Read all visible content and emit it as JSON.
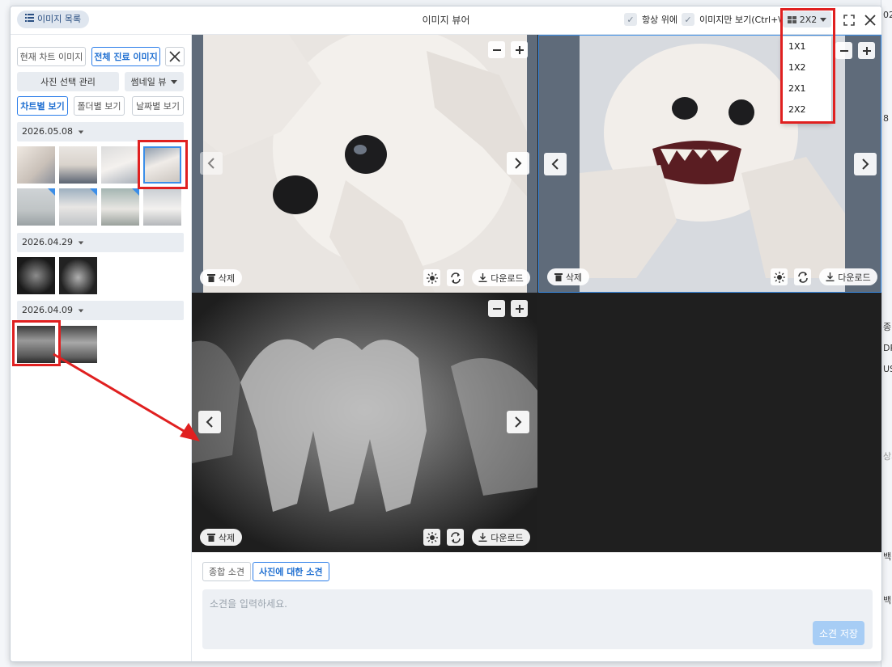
{
  "window": {
    "title": "이미지 뷰어",
    "list_button_label": "이미지 목록",
    "always_on_top_label": "항상 위에",
    "image_only_label": "이미지만 보기(Ctrl+\\)",
    "layout_selected": "2X2",
    "layout_options": [
      "1X1",
      "1X2",
      "2X1",
      "2X2"
    ]
  },
  "sidebar": {
    "btn_current_chart": "현재 차트 이미지",
    "btn_all_records": "전체 진료 이미지",
    "btn_photo_manage": "사진 선택 관리",
    "btn_thumbnail_view": "썸네일 뷰",
    "view_tabs": [
      "차트별 보기",
      "폴더별 보기",
      "날짜별 보기"
    ],
    "groups": [
      {
        "date": "2026.05.08",
        "count": 8
      },
      {
        "date": "2026.04.29",
        "count": 2
      },
      {
        "date": "2026.04.09",
        "count": 2
      }
    ]
  },
  "viewer": {
    "delete_label": "삭제",
    "download_label": "다운로드"
  },
  "notes": {
    "tab_general": "종합 소견",
    "tab_photo": "사진에 대한 소견",
    "placeholder": "소견을 입력하세요.",
    "save_label": "소견 저장"
  },
  "background_fragments": [
    "02",
    "8",
    "종i",
    "DR",
    "US",
    "상세",
    "백신",
    "백..."
  ],
  "colors": {
    "accent": "#2b7de9",
    "highlight": "#e02020",
    "save_disabled": "#a7cdf5"
  }
}
